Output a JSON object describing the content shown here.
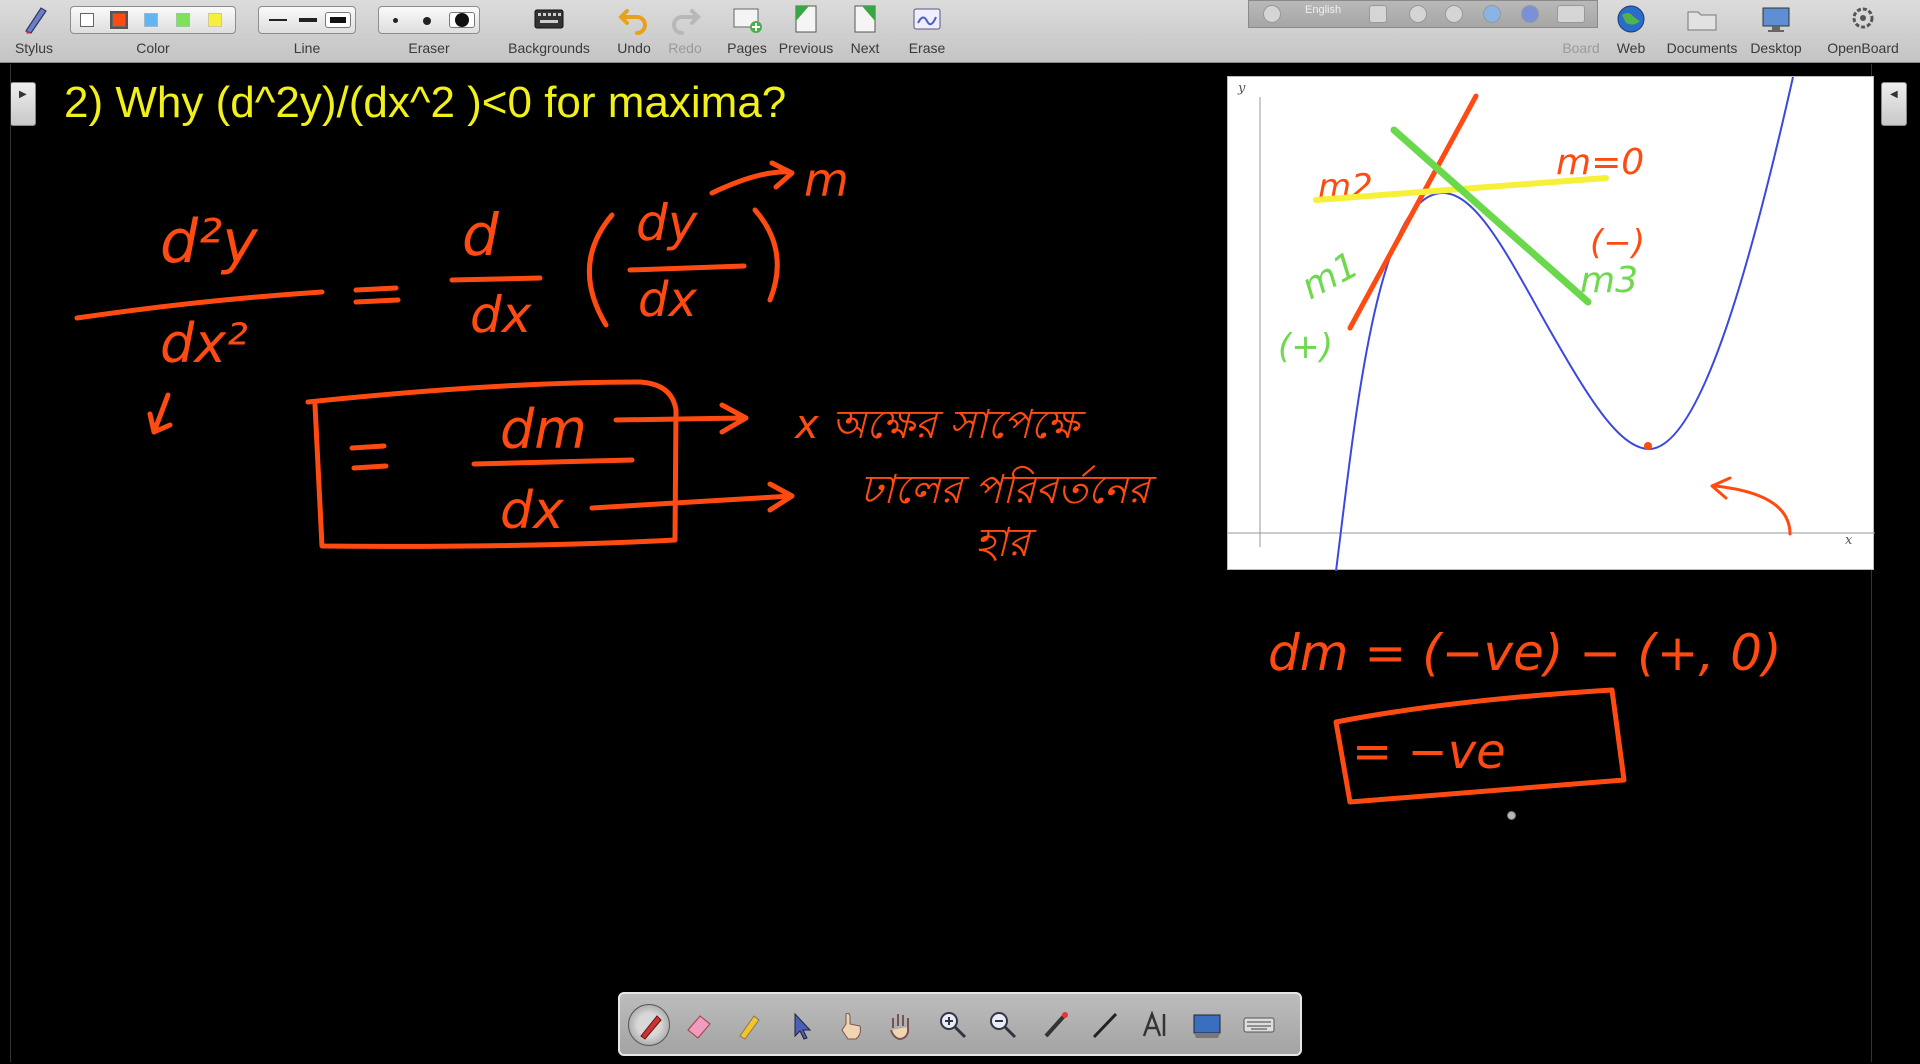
{
  "toolbar": {
    "stylus": "Stylus",
    "color": "Color",
    "line": "Line",
    "eraser": "Eraser",
    "backgrounds": "Backgrounds",
    "undo": "Undo",
    "redo": "Redo",
    "pages": "Pages",
    "previous": "Previous",
    "next": "Next",
    "erase": "Erase",
    "board": "Board",
    "web": "Web",
    "documents": "Documents",
    "desktop": "Desktop",
    "openboard": "OpenBoard",
    "colors": [
      "#ffffff",
      "#ff4b12",
      "#62b6f0",
      "#7fe05a",
      "#f6f03a"
    ],
    "selected_color": "#ff4b12"
  },
  "float_bar": {
    "language": "English"
  },
  "board": {
    "title": "2) Why (d^2y)/(dx^2 )<0 for maxima?",
    "title_color": "#f1f01a",
    "ink_color": "#ff4b12",
    "graph_ink_colors": {
      "tangent_m2": "#f6f03a",
      "tangent_m3": "#69d84a",
      "labels": "#6fd84f",
      "curve": "#3b48e0"
    }
  },
  "graph": {
    "x_axis_label": "x",
    "y_axis_label": "y"
  },
  "handwriting": {
    "eq1_left_num": "d²y",
    "eq1_left_den": "dx²",
    "eq1_op_d": "d",
    "eq1_op_dx": "dx",
    "eq1_inner_num": "dy",
    "eq1_inner_den": "dx",
    "eq1_m": "m",
    "eq2_num": "dm",
    "eq2_den": "dx",
    "eq2_x_text": "x অক্ষের সাপেক্ষে",
    "eq2_slope_text": "ঢালের পরিবর্তনের",
    "eq2_rate_text": "হার",
    "g_m2": "m2",
    "g_m0": "m=0",
    "g_m1": "m1",
    "g_plus": "(+)",
    "g_minus": "(−)",
    "g_m3": "m3",
    "calc_line": "dm = (−ve) − (+, 0)",
    "calc_result": "= −ve"
  }
}
